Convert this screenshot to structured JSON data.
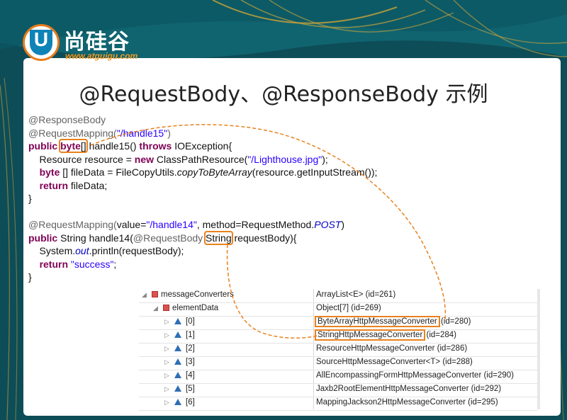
{
  "logo": {
    "letter": "U",
    "name_cn": "尚硅谷",
    "url": "www.atguigu.com"
  },
  "slide": {
    "title": "@RequestBody、@ResponseBody 示例"
  },
  "code": {
    "m1": {
      "ann1": "@ResponseBody",
      "ann2": "@RequestMapping(",
      "ann2_str": "\"/handle15\"",
      "ann2_end": ")",
      "sig_public": "public",
      "sig_type": "byte",
      "sig_arr": "[]",
      "sig_name": " handle15() ",
      "sig_throws": "throws",
      "sig_rest": " IOException{",
      "l1_a": "    Resource resource = ",
      "l1_new": "new",
      "l1_b": " ClassPathResource(",
      "l1_str": "\"/Lighthouse.jpg\"",
      "l1_c": ");",
      "l2_byte": "byte",
      "l2_a": " [] fileData = FileCopyUtils.",
      "l2_m": "copyToByteArray",
      "l2_b": "(resource.getInputStream());",
      "l3_ret": "return",
      "l3_a": " fileData;",
      "close": "}"
    },
    "m2": {
      "ann_a": "@RequestMapping(",
      "ann_value": "value=",
      "ann_str": "\"/handle14\"",
      "ann_b": ", method=RequestMethod.",
      "ann_post": "POST",
      "ann_c": ")",
      "sig_public": "public",
      "sig_a": " String handle14(",
      "sig_ann": "@RequestBody",
      "sig_type": "String",
      "sig_b": " requestBody){",
      "l1_a": "    System.",
      "l1_out": "out",
      "l1_b": ".println(requestBody);",
      "l2_ret": "return",
      "l2_str": "\"success\"",
      "l2_b": ";",
      "close": "}"
    }
  },
  "debug_tree": {
    "rows": [
      {
        "name": "messageConverters",
        "value": "ArrayList<E>  (id=261)"
      },
      {
        "name": "elementData",
        "value": "Object[7]  (id=269)"
      },
      {
        "name": "[0]",
        "value": "ByteArrayHttpMessageConverter",
        "id": "(id=280)"
      },
      {
        "name": "[1]",
        "value": "StringHttpMessageConverter",
        "id": "(id=284)"
      },
      {
        "name": "[2]",
        "value": "ResourceHttpMessageConverter  (id=286)"
      },
      {
        "name": "[3]",
        "value": "SourceHttpMessageConverter<T>  (id=288)"
      },
      {
        "name": "[4]",
        "value": "AllEncompassingFormHttpMessageConverter  (id=290)"
      },
      {
        "name": "[5]",
        "value": "Jaxb2RootElementHttpMessageConverter  (id=292)"
      },
      {
        "name": "[6]",
        "value": "MappingJackson2HttpMessageConverter  (id=295)"
      }
    ]
  },
  "colors": {
    "accent_box": "#e8821e",
    "keyword": "#7f0055",
    "string": "#2a00ff",
    "annotation": "#646464"
  }
}
